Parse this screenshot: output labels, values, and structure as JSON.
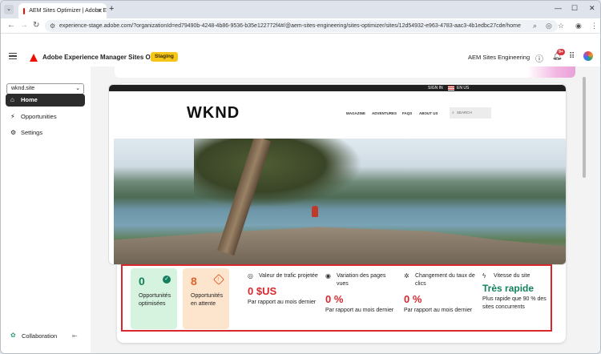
{
  "browser": {
    "tab_title": "AEM Sites Optimizer | Adobe E",
    "new_tab": "+",
    "url": "experience-stage.adobe.com/?organizationId=ed79490b-4248-4b86-9536-b35e122772f4#/@aem-sites-engineering/sites-optimizer/sites/12d54932-e963-4783-aac3-4b1edbc27cde/home"
  },
  "header": {
    "app_title": "Adobe Experience Manager Sites Optimizer",
    "env_badge": "Staging",
    "org_name": "AEM Sites Engineering",
    "notification_count": "9+"
  },
  "sidebar": {
    "site_select": "wknd.site",
    "items": [
      {
        "label": "Home",
        "icon": "home-icon"
      },
      {
        "label": "Opportunities",
        "icon": "opportunities-icon"
      },
      {
        "label": "Settings",
        "icon": "gear-icon"
      }
    ],
    "collaboration": "Collaboration"
  },
  "preview": {
    "sign_in": "SIGN IN",
    "lang": "EN US",
    "logo": "WKND",
    "nav": [
      "MAGAZINE",
      "ADVENTURES",
      "FAQS",
      "ABOUT US"
    ],
    "search": "SEARCH"
  },
  "metrics": {
    "optimized": {
      "value": "0",
      "label": "Opportunités optimisées"
    },
    "pending": {
      "value": "8",
      "label": "Opportunités en attente"
    },
    "traffic": {
      "title": "Valeur de trafic projetée",
      "value": "0 $US",
      "sub": "Par rapport au mois dernier"
    },
    "pageviews": {
      "title": "Variation des pages vues",
      "value": "0 %",
      "sub": "Par rapport au mois dernier"
    },
    "ctr": {
      "title": "Changement du taux de clics",
      "value": "0 %",
      "sub": "Par rapport au mois dernier"
    },
    "speed": {
      "title": "Vitesse du site",
      "value": "Très rapide",
      "sub": "Plus rapide que 90 % des sites concurrents"
    }
  },
  "colors": {
    "accent_red": "#d9272e",
    "green": "#12805c",
    "orange": "#e2612c",
    "staging": "#f5c518"
  }
}
